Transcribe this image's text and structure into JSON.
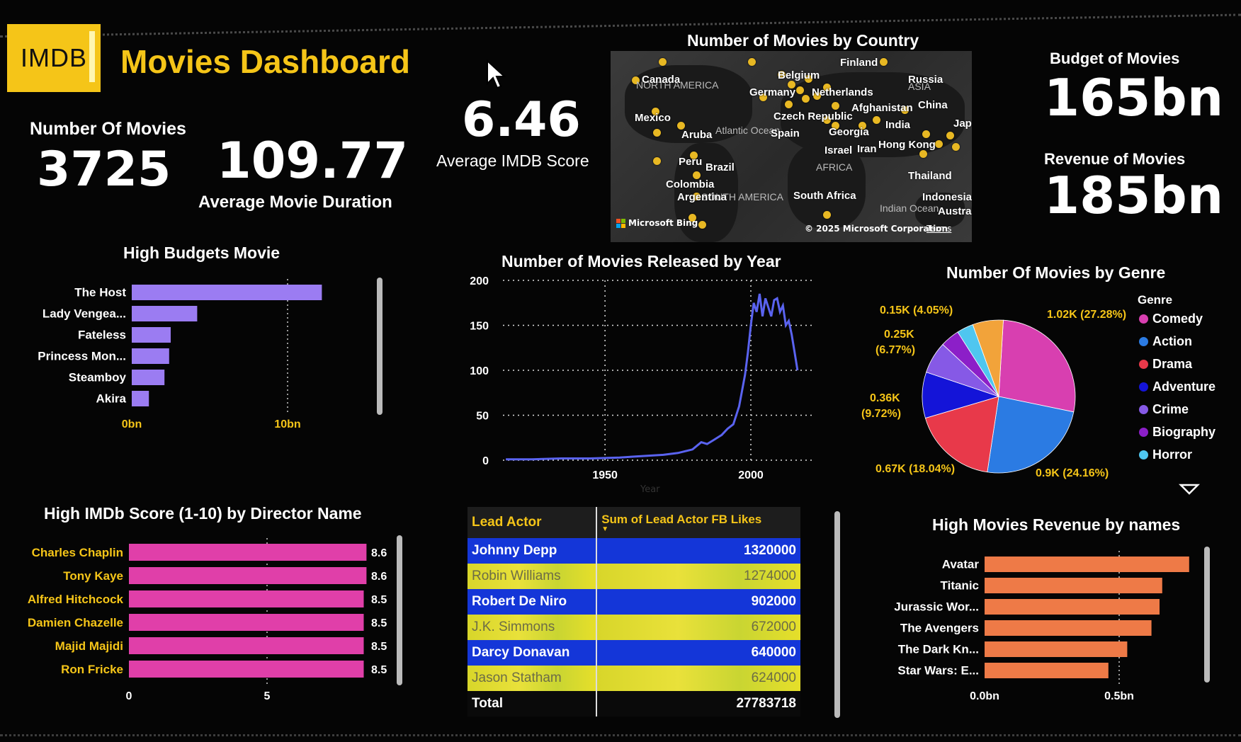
{
  "header": {
    "logo_text": "IMDB",
    "title": "Movies Dashboard"
  },
  "kpis": {
    "movies_count_label": "Number Of Movies",
    "movies_count": "3725",
    "avg_duration": "109.77",
    "avg_duration_label": "Average Movie Duration",
    "avg_score": "6.46",
    "avg_score_label": "Average IMDB Score",
    "budget_label": "Budget of Movies",
    "budget": "165bn",
    "revenue_label": "Revenue of Movies",
    "revenue": "185bn"
  },
  "map": {
    "title": "Number of Movies by Country",
    "countries": [
      "Canada",
      "Finland",
      "Russia",
      "Belgium",
      "Germany",
      "Netherlands",
      "Mexico",
      "Czech Republic",
      "Afghanistan",
      "China",
      "Aruba",
      "Spain",
      "Georgia",
      "India",
      "Japan",
      "Israel",
      "Iran",
      "Hong Kong",
      "Peru",
      "Brazil",
      "Thailand",
      "Colombia",
      "South Africa",
      "Argentina",
      "Indonesia",
      "Australia"
    ],
    "regions": [
      "NORTH AMERICA",
      "ASIA",
      "Atlantic Ocean",
      "AFRICA",
      "SOUTH AMERICA",
      "Indian Ocean"
    ],
    "attribution": "Microsoft Bing",
    "copyright": "© 2025 Microsoft Corporation",
    "terms": "Terms"
  },
  "high_budget": {
    "title": "High Budgets Movie",
    "categories": [
      "The Host",
      "Lady Vengea...",
      "Fateless",
      "Princess Mon...",
      "Steamboy",
      "Akira"
    ],
    "values": [
      12.2,
      4.2,
      2.5,
      2.4,
      2.1,
      1.1
    ],
    "ticks": [
      "0bn",
      "10bn"
    ],
    "tick_values": [
      0,
      10
    ],
    "max": 13,
    "color": "#9b7cf2"
  },
  "year_chart": {
    "title": "Number of Movies Released by Year",
    "xlabel": "Year",
    "y_ticks": [
      "200",
      "150",
      "100",
      "50",
      "0"
    ],
    "x_ticks": [
      "1950",
      "2000"
    ],
    "color": "#5a63f0"
  },
  "genre": {
    "title": "Number Of Movies by Genre",
    "legend_title": "Genre",
    "items": [
      {
        "name": "Comedy",
        "color": "#d83fb0"
      },
      {
        "name": "Action",
        "color": "#2b7be3"
      },
      {
        "name": "Drama",
        "color": "#e8394a"
      },
      {
        "name": "Adventure",
        "color": "#1414d8"
      },
      {
        "name": "Crime",
        "color": "#8659e6"
      },
      {
        "name": "Biography",
        "color": "#8c1fc8"
      },
      {
        "name": "Horror",
        "color": "#4fc6ef"
      }
    ],
    "labels": {
      "comedy": "1.02K (27.28%)",
      "action": "0.9K (24.16%)",
      "drama": "0.67K (18.04%)",
      "adventure_1": "0.36K",
      "adventure_2": "(9.72%)",
      "crime_1": "0.25K",
      "crime_2": "(6.77%)",
      "biography": "0.15K (4.05%)"
    }
  },
  "chart_data": [
    {
      "type": "bar",
      "title": "High Budgets Movie",
      "categories": [
        "The Host",
        "Lady Vengea...",
        "Fateless",
        "Princess Mon...",
        "Steamboy",
        "Akira"
      ],
      "values": [
        12.2,
        4.2,
        2.5,
        2.4,
        2.1,
        1.1
      ],
      "ylabel": "",
      "x_ticks": [
        "0bn",
        "10bn"
      ]
    },
    {
      "type": "line",
      "title": "Number of Movies Released by Year",
      "xlabel": "Year",
      "x": [
        1916,
        1925,
        1935,
        1945,
        1955,
        1960,
        1965,
        1970,
        1975,
        1980,
        1983,
        1985,
        1987,
        1990,
        1992,
        1994,
        1996,
        1998,
        1999,
        2000,
        2001,
        2002,
        2003,
        2004,
        2005,
        2006,
        2007,
        2008,
        2009,
        2010,
        2011,
        2012,
        2013,
        2014,
        2015,
        2016
      ],
      "series": [
        {
          "values": [
            1,
            1,
            2,
            2,
            3,
            4,
            5,
            6,
            8,
            12,
            20,
            18,
            22,
            28,
            35,
            40,
            60,
            95,
            120,
            150,
            175,
            165,
            185,
            160,
            180,
            170,
            160,
            178,
            180,
            165,
            172,
            150,
            155,
            140,
            120,
            100
          ]
        }
      ],
      "ylim": [
        0,
        200
      ]
    },
    {
      "type": "pie",
      "title": "Number Of Movies by Genre",
      "categories": [
        "Comedy",
        "Action",
        "Drama",
        "Adventure",
        "Crime",
        "Biography",
        "Horror",
        "Other"
      ],
      "values": [
        27.28,
        24.16,
        18.04,
        9.72,
        6.77,
        4.05,
        3.5,
        6.48
      ]
    },
    {
      "type": "bar",
      "title": "High IMDb Score (1-10) by Director Name",
      "categories": [
        "Charles Chaplin",
        "Tony Kaye",
        "Alfred Hitchcock",
        "Damien Chazelle",
        "Majid Majidi",
        "Ron Fricke"
      ],
      "values": [
        8.6,
        8.6,
        8.5,
        8.5,
        8.5,
        8.5
      ],
      "x_ticks": [
        "0",
        "5"
      ]
    },
    {
      "type": "table",
      "columns": [
        "Lead Actor",
        "Sum of Lead Actor FB Likes"
      ],
      "rows": [
        [
          "Johnny Depp",
          "1320000"
        ],
        [
          "Robin Williams",
          "1274000"
        ],
        [
          "Robert De Niro",
          "902000"
        ],
        [
          "J.K. Simmons",
          "672000"
        ],
        [
          "Darcy Donavan",
          "640000"
        ],
        [
          "Jason Statham",
          "624000"
        ]
      ],
      "total": [
        "Total",
        "27783718"
      ]
    },
    {
      "type": "bar",
      "title": "High Movies Revenue by names",
      "categories": [
        "Avatar",
        "Titanic",
        "Jurassic Wor...",
        "The Avengers",
        "The Dark Kn...",
        "Star Wars: E..."
      ],
      "values": [
        0.76,
        0.66,
        0.65,
        0.62,
        0.53,
        0.46
      ],
      "x_ticks": [
        "0.0bn",
        "0.5bn"
      ]
    }
  ],
  "directors": {
    "title": "High IMDb Score (1-10) by Director Name",
    "categories": [
      "Charles Chaplin",
      "Tony Kaye",
      "Alfred Hitchcock",
      "Damien Chazelle",
      "Majid Majidi",
      "Ron Fricke"
    ],
    "values": [
      8.6,
      8.6,
      8.5,
      8.5,
      8.5,
      8.5
    ],
    "value_labels": [
      "8.6",
      "8.6",
      "8.5",
      "8.5",
      "8.5",
      "8.5"
    ],
    "ticks": [
      "0",
      "5"
    ],
    "color": "#e03fa9"
  },
  "actors": {
    "col1": "Lead Actor",
    "col2": "Sum of Lead Actor FB Likes",
    "rows": [
      {
        "name": "Johnny Depp",
        "likes": "1320000"
      },
      {
        "name": "Robin Williams",
        "likes": "1274000"
      },
      {
        "name": "Robert De Niro",
        "likes": "902000"
      },
      {
        "name": "J.K. Simmons",
        "likes": "672000"
      },
      {
        "name": "Darcy Donavan",
        "likes": "640000"
      },
      {
        "name": "Jason Statham",
        "likes": "624000"
      }
    ],
    "total_label": "Total",
    "total": "27783718"
  },
  "revenue_chart": {
    "title": "High Movies Revenue by names",
    "categories": [
      "Avatar",
      "Titanic",
      "Jurassic Wor...",
      "The Avengers",
      "The Dark Kn...",
      "Star Wars: E..."
    ],
    "values": [
      0.76,
      0.66,
      0.65,
      0.62,
      0.53,
      0.46
    ],
    "ticks": [
      "0.0bn",
      "0.5bn"
    ],
    "color": "#ee7a47"
  }
}
